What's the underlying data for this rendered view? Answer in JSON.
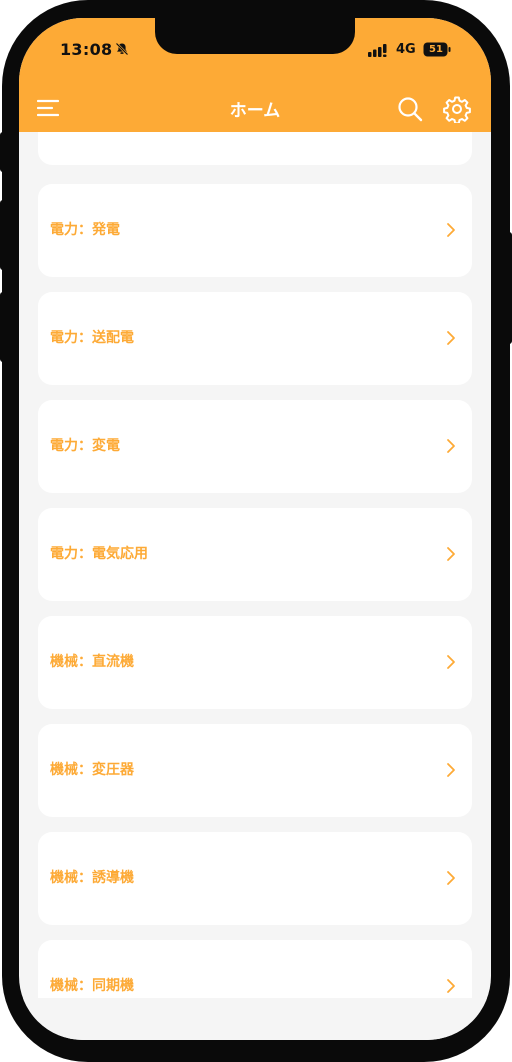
{
  "status_bar": {
    "time": "13:08",
    "network": "4G",
    "battery": "51",
    "icons": [
      "bell-slash-icon",
      "signal-icon",
      "battery-icon"
    ]
  },
  "header": {
    "title": "ホーム",
    "icons": [
      "menu-icon",
      "search-icon",
      "gear-icon"
    ]
  },
  "categories": [
    {
      "label": ""
    },
    {
      "label": "電力：発電"
    },
    {
      "label": "電力：送配電"
    },
    {
      "label": "電力：変電"
    },
    {
      "label": "電力：電気応用"
    },
    {
      "label": "機械：直流機"
    },
    {
      "label": "機械：変圧器"
    },
    {
      "label": "機械：誘導機"
    },
    {
      "label": "機械：同期機"
    }
  ],
  "colors": {
    "accent": "#fdaa36",
    "background": "#f5f5f5",
    "card": "#ffffff"
  }
}
